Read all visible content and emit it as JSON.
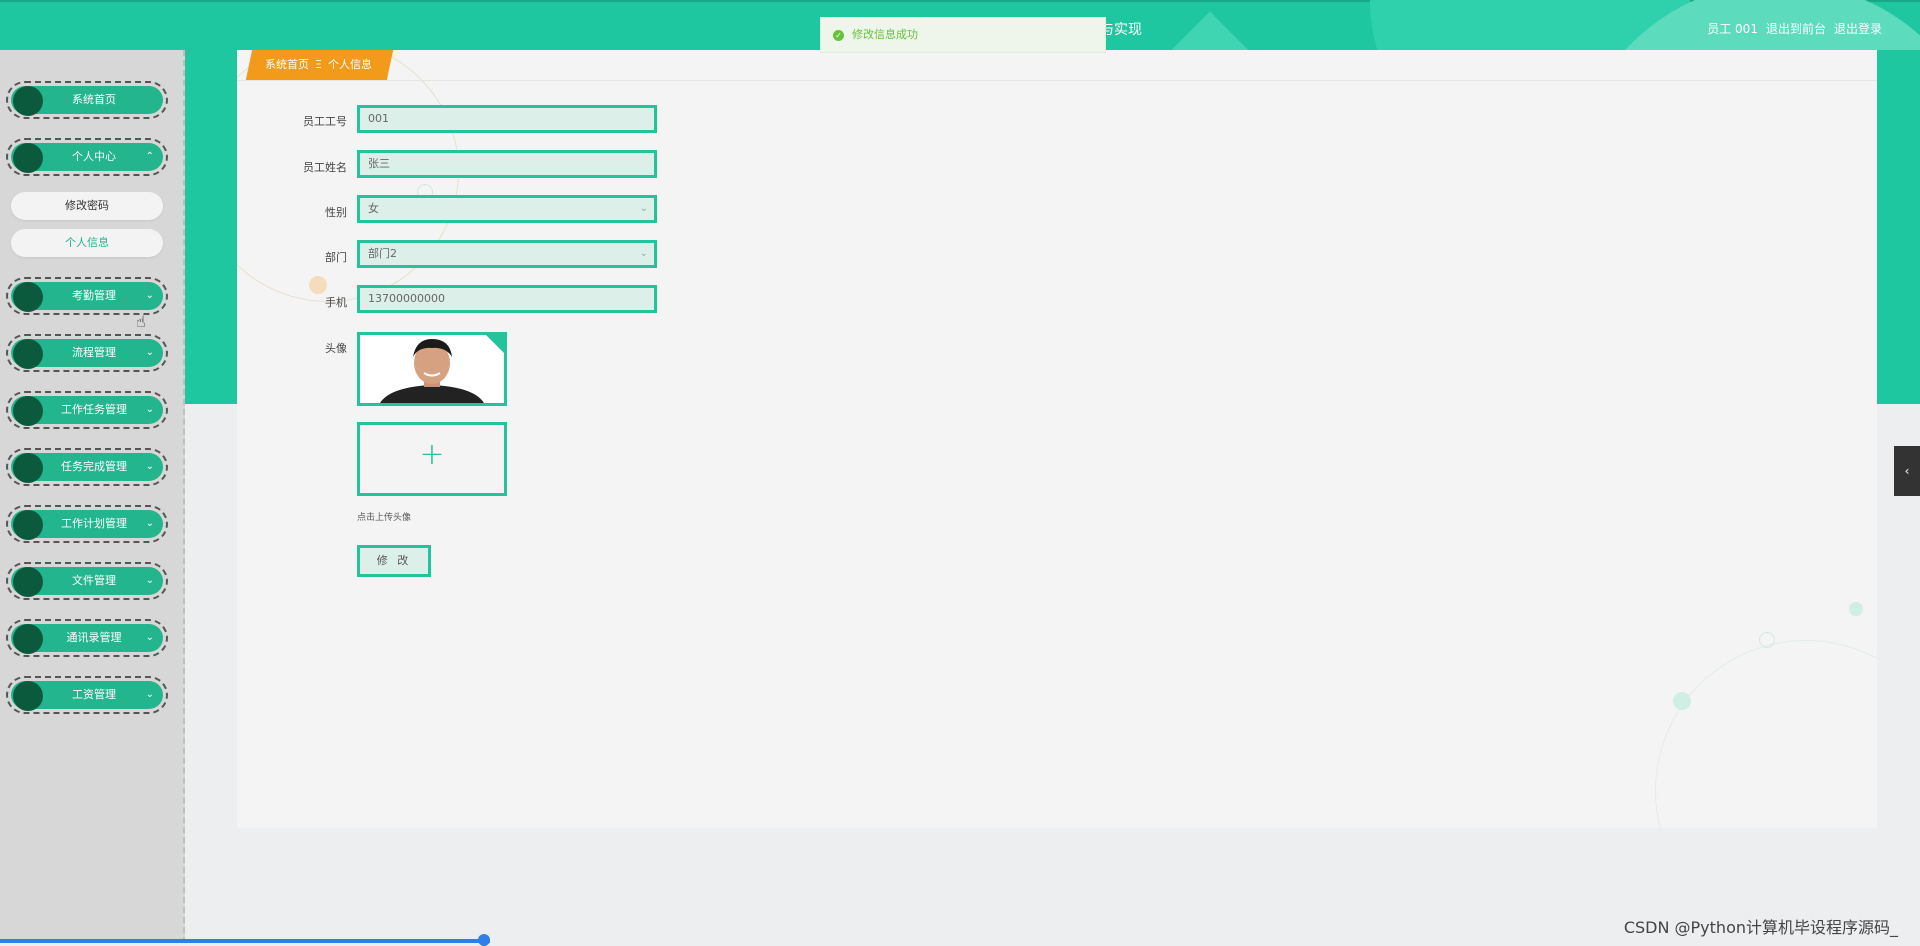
{
  "header": {
    "title": "与实现",
    "user_label": "员工 001",
    "back_link": "退出到前台",
    "logout_link": "退出登录"
  },
  "toast": {
    "message": "修改信息成功"
  },
  "sidebar": {
    "items": [
      {
        "label": "系统首页",
        "has_chevron": false
      },
      {
        "label": "个人中心",
        "chevron": "⌃"
      },
      {
        "label": "考勤管理",
        "chevron": "⌄"
      },
      {
        "label": "流程管理",
        "chevron": "⌄"
      },
      {
        "label": "工作任务管理",
        "chevron": "⌄"
      },
      {
        "label": "任务完成管理",
        "chevron": "⌄"
      },
      {
        "label": "工作计划管理",
        "chevron": "⌄"
      },
      {
        "label": "文件管理",
        "chevron": "⌄"
      },
      {
        "label": "通讯录管理",
        "chevron": "⌄"
      },
      {
        "label": "工资管理",
        "chevron": "⌄"
      }
    ],
    "sub_items": [
      {
        "label": "修改密码"
      },
      {
        "label": "个人信息"
      }
    ]
  },
  "breadcrumb": {
    "home": "系统首页",
    "separator": "Ξ",
    "current": "个人信息"
  },
  "form": {
    "employee_no": {
      "label": "员工工号",
      "value": "001"
    },
    "employee_name": {
      "label": "员工姓名",
      "value": "张三"
    },
    "gender": {
      "label": "性别",
      "value": "女"
    },
    "department": {
      "label": "部门",
      "value": "部门2"
    },
    "phone": {
      "label": "手机",
      "value": "13700000000"
    },
    "avatar": {
      "label": "头像"
    },
    "upload_hint": "点击上传头像",
    "submit_label": "修 改"
  },
  "watermark": "CSDN @Python计算机毕设程序源码_",
  "colors": {
    "primary": "#1fc7a1",
    "breadcrumb": "#f29b1b",
    "menu": "#23b58e",
    "success": "#67c23a"
  }
}
